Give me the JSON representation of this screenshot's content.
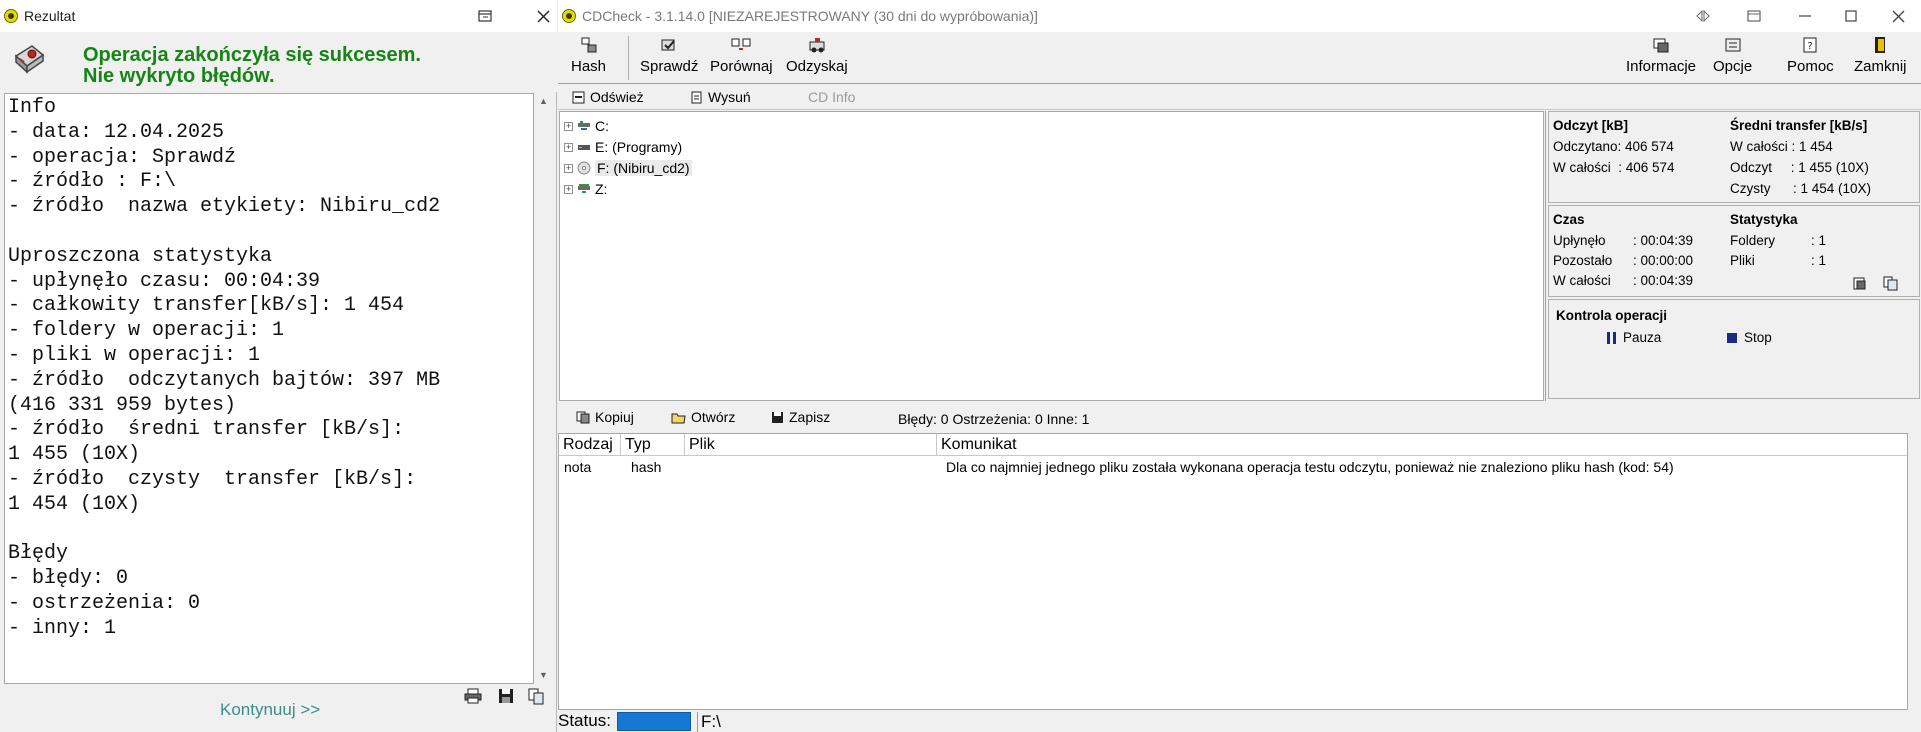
{
  "left_window": {
    "title": "Rezultat",
    "header": {
      "line1": "Operacja zakończyła się sukcesem.",
      "line2": "Nie wykryto błędów."
    },
    "info_lines": [
      "Info",
      "- data: 12.04.2025",
      "- operacja: Sprawdź",
      "- źródło : F:\\",
      "- źródło  nazwa etykiety: Nibiru_cd2",
      "",
      "Uproszczona statystyka",
      "- upłynęło czasu: 00:04:39",
      "- całkowity transfer[kB/s]: 1 454",
      "- foldery w operacji: 1",
      "- pliki w operacji: 1",
      "- źródło  odczytanych bajtów: 397 MB",
      "(416 331 959 bytes)",
      "- źródło  średni transfer [kB/s]:",
      "1 455 (10X)",
      "- źródło  czysty  transfer [kB/s]:",
      "1 454 (10X)",
      "",
      "Błędy",
      "- błędy: 0",
      "- ostrzeżenia: 0",
      "- inny: 1"
    ],
    "continue_label": "Kontynuuj >>"
  },
  "right_window": {
    "title": "CDCheck - 3.1.14.0 [NIEZAREJESTROWANY (30 dni do wypróbowania)]",
    "toolbar": {
      "hash": "Hash",
      "sprawdz": "Sprawdź",
      "porownaj": "Porównaj",
      "odzyskaj": "Odzyskaj",
      "informacje": "Informacje",
      "opcje": "Opcje",
      "pomoc": "Pomoc",
      "zamknij": "Zamknij"
    },
    "subbar": {
      "odswiez": "Odśwież",
      "wysun": "Wysuń",
      "cdinfo": "CD Info"
    },
    "drives": [
      {
        "label": "C:"
      },
      {
        "label": "E: (Programy)"
      },
      {
        "label": "F: (Nibiru_cd2)"
      },
      {
        "label": "Z:"
      }
    ],
    "stats": {
      "read_title": "Odczyt [kB]",
      "read_done": "Odczytano: 406 574",
      "read_total": "W całości  : 406 574",
      "transfer_title": "Średni transfer [kB/s]",
      "transfer_total": "W całości : 1 454",
      "transfer_read": "Odczyt     : 1 455 (10X)",
      "transfer_clean": "Czysty      : 1 454 (10X)",
      "time_title": "Czas",
      "elapsed": "Upłynęło",
      "elapsed_val": ": 00:04:39",
      "remaining": "Pozostało",
      "remaining_val": ": 00:00:00",
      "time_total": "W całości",
      "time_total_val": ": 00:04:39",
      "stat_title": "Statystyka",
      "folders": "Foldery",
      "folders_val": ": 1",
      "files": "Pliki",
      "files_val": ": 1",
      "control_title": "Kontrola operacji",
      "pause": "Pauza",
      "stop": "Stop"
    },
    "logbar": {
      "kopiuj": "Kopiuj",
      "otworz": "Otwórz",
      "zapisz": "Zapisz",
      "summary": "Błędy: 0 Ostrzeżenia: 0 Inne: 1"
    },
    "log_columns": [
      "Rodzaj",
      "Typ",
      "Plik",
      "Komunikat"
    ],
    "log_rows": [
      {
        "rodzaj": "nota",
        "typ": "hash",
        "plik": "",
        "komunikat": "Dla co najmniej jednego pliku została wykonana operacja testu odczytu, ponieważ nie znaleziono pliku hash (kod: 54)"
      }
    ],
    "status": {
      "label": "Status:",
      "path": "F:\\"
    }
  },
  "colors": {
    "success_green": "#168516",
    "progress_blue": "#1877d2",
    "continue_teal": "#3a8f86"
  }
}
